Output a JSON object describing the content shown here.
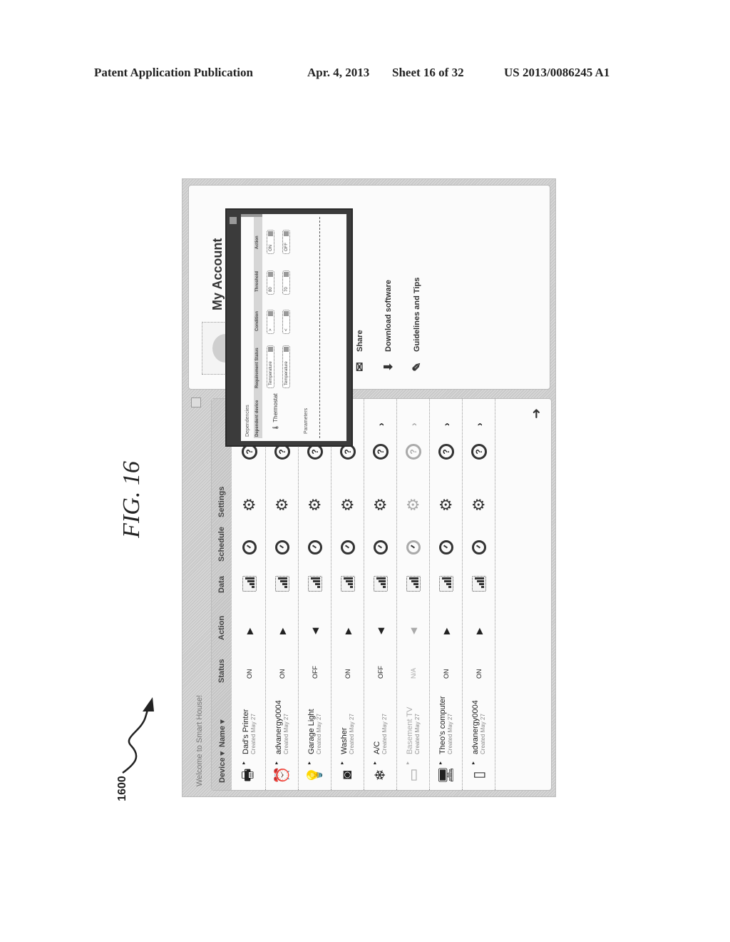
{
  "header": {
    "left": "Patent Application Publication",
    "date": "Apr. 4, 2013",
    "sheet": "Sheet 16 of 32",
    "pub_number": "US 2013/0086245 A1"
  },
  "figure": {
    "title": "FIG. 16",
    "reference": "1600"
  },
  "app": {
    "welcome": "Welcome to Smart House!",
    "table": {
      "headers": {
        "device": "Device ▾",
        "name": "Name ▾",
        "status": "Status",
        "action": "Action",
        "data": "Data",
        "schedule": "Schedule",
        "settings": "Settings"
      },
      "rows": [
        {
          "icon": "printer-icon",
          "glyph": "🖶",
          "name": "Dad's Printer",
          "created": "Created May 27",
          "status": "ON",
          "action": "▶",
          "dim": false
        },
        {
          "icon": "alarm-clock-icon",
          "glyph": "⏰",
          "name": "advanergy0004",
          "created": "Created May 27",
          "status": "ON",
          "action": "▶",
          "dim": false
        },
        {
          "icon": "light-bulb-icon",
          "glyph": "💡",
          "name": "Garage Light",
          "created": "Created May 27",
          "status": "OFF",
          "action": "◀",
          "dim": false
        },
        {
          "icon": "washer-icon",
          "glyph": "◙",
          "name": "Washer",
          "created": "Created May 27",
          "status": "ON",
          "action": "▶",
          "dim": false
        },
        {
          "icon": "snowflake-icon",
          "glyph": "❄",
          "name": "A/C",
          "created": "Created May 27",
          "status": "OFF",
          "action": "◀",
          "dim": false
        },
        {
          "icon": "tv-icon",
          "glyph": "▭",
          "name": "Basement TV",
          "created": "Created May 27",
          "status": "N/A",
          "action": "◀",
          "dim": true
        },
        {
          "icon": "computer-icon",
          "glyph": "🖥",
          "name": "Theo's computer",
          "created": "Created May 27",
          "status": "ON",
          "action": "▶",
          "dim": false
        },
        {
          "icon": "tablet-icon",
          "glyph": "▯",
          "name": "advanergy0004",
          "created": "Created May 27",
          "status": "ON",
          "action": "▶",
          "dim": false
        }
      ]
    },
    "account": {
      "title": "My Account",
      "menu": [
        {
          "icon": "envelope-icon",
          "glyph": "✉",
          "label": "Share"
        },
        {
          "icon": "download-icon",
          "glyph": "⬇",
          "label": "Download software"
        },
        {
          "icon": "edit-icon",
          "glyph": "✎",
          "label": "Guidelines and Tips"
        }
      ]
    },
    "dependency_popup": {
      "title": "Dependencies",
      "columns": [
        "Dependent device",
        "Requirement Status",
        "Condition",
        "Threshold",
        "Action"
      ],
      "device": "Thermostat",
      "rows": [
        {
          "requirement": "Temperature",
          "condition": ">",
          "threshold": "80",
          "action": "ON"
        },
        {
          "requirement": "Temperature",
          "condition": "<",
          "threshold": "70",
          "action": "OFF"
        }
      ],
      "parameters_label": "Parameters"
    }
  }
}
